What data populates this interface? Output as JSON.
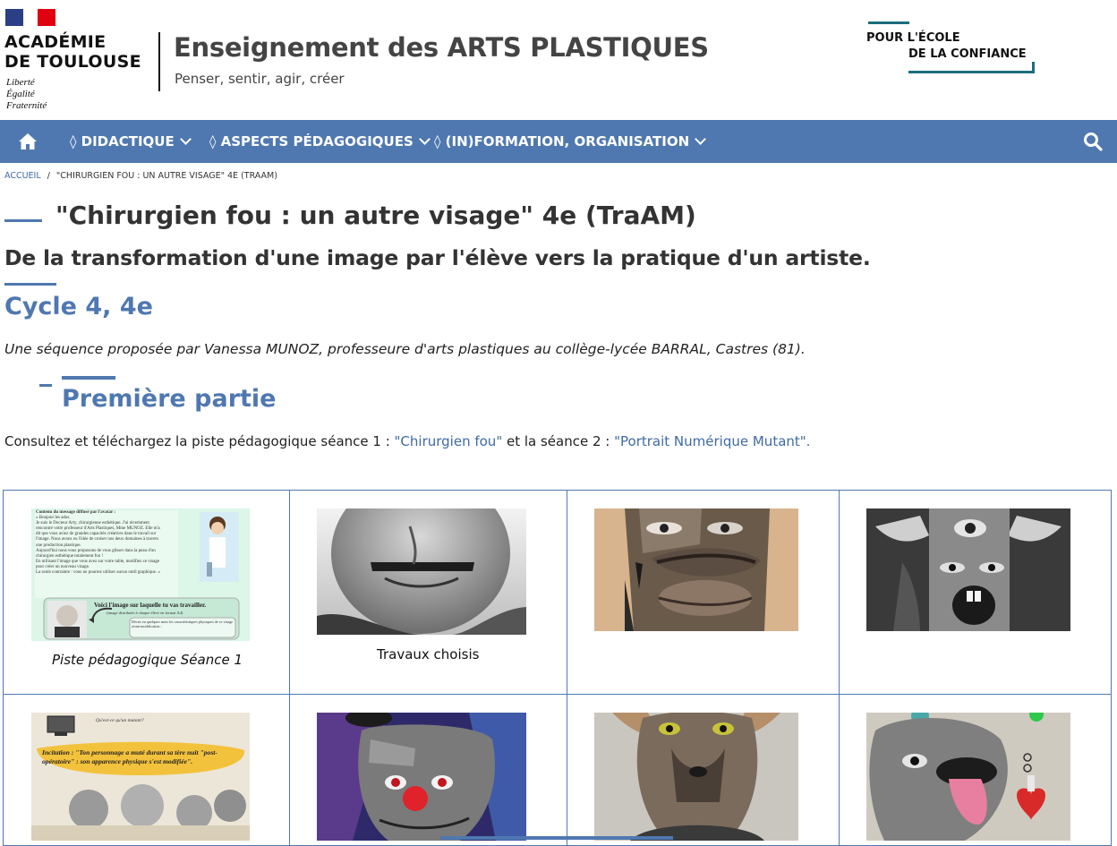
{
  "header": {
    "institution_line1": "ACADÉMIE",
    "institution_line2": "DE TOULOUSE",
    "motto": [
      "Liberté",
      "Égalité",
      "Fraternité"
    ],
    "site_title": "Enseignement des ARTS PLASTIQUES",
    "site_tagline": "Penser, sentir, agir, créer",
    "partner_line1": "POUR L'ÉCOLE",
    "partner_line2": "DE LA CONFIANCE"
  },
  "nav": {
    "items": [
      {
        "label": "◊ DIDACTIQUE"
      },
      {
        "label": "◊ ASPECTS PÉDAGOGIQUES"
      },
      {
        "label": "◊ (IN)FORMATION, ORGANISATION"
      }
    ],
    "home_icon": "home-icon",
    "search_icon": "search-icon"
  },
  "breadcrumb": {
    "home": "ACCUEIL",
    "separator": "/",
    "current": "\"CHIRURGIEN FOU : UN AUTRE VISAGE\" 4E (TRAAM)"
  },
  "article": {
    "title": "\"Chirurgien fou : un autre visage\" 4e (TraAM)",
    "subtitle": "De la transformation d'une image par l'élève vers la pratique d'un artiste.",
    "cycle": "Cycle 4, 4e",
    "byline": "Une séquence proposée par Vanessa MUNOZ, professeure d'arts plastiques au collège-lycée BARRAL, Castres (81).",
    "section_title": "Première partie",
    "intro_text": "Consultez et téléchargez la piste pédagogique séance 1 : ",
    "link1": "\"Chirurgien fou\"",
    "mid_text": " et la séance 2 : ",
    "link2": "\"Portrait Numérique Mutant\".",
    "end_text": ""
  },
  "gallery": {
    "captions": [
      "Piste pédagogique Séance 1",
      "Travaux choisis",
      "",
      ""
    ],
    "doc1_text": [
      "Contenu du message diffusé par l'avatar :",
      "« Bonjour les ados.",
      "Je suis le Docteur Arty, chirurgienne esthétique. J'ai récemment",
      "rencontré votre professeur d'Arts Plastiques, Mme MUNOZ. Elle m'a",
      "dit que vous aviez de grandes capacités créatives dans le travail sur",
      "l'image. Nous avons eu l'idée de croiser nos deux domaines à travers",
      "une production plastique.",
      "Aujourd'hui nous vous proposons de vous glisser dans la peau d'un",
      "chirurgien esthétique totalement fou !",
      "En utilisant l'image que vous avez sur votre table, modifiez ce visage",
      "pour créer un nouveau visage.",
      "La seule contrainte : vous ne pourrez utiliser aucun outil graphique. »"
    ],
    "doc1_box_title": "Voici l'image sur laquelle tu vas travailler.",
    "doc1_box_sub": "(image distribuée à chaque élève en format A4)",
    "doc1_box_note": "Décris en quelques mots les caractéristiques physiques de ce visage avant modification :",
    "doc2_question": "Qu'est-ce qu'un mutant?",
    "doc2_incitation": "Incitation : \"Ton personnage a muté durant sa tère nuit \"post-opératoire\" : son apparence physique s'est modifiée\"."
  },
  "colors": {
    "accent": "#4f78b0",
    "flag_blue": "#2a3f86",
    "flag_red": "#e1000f",
    "partner_teal": "#1a6d7e"
  }
}
